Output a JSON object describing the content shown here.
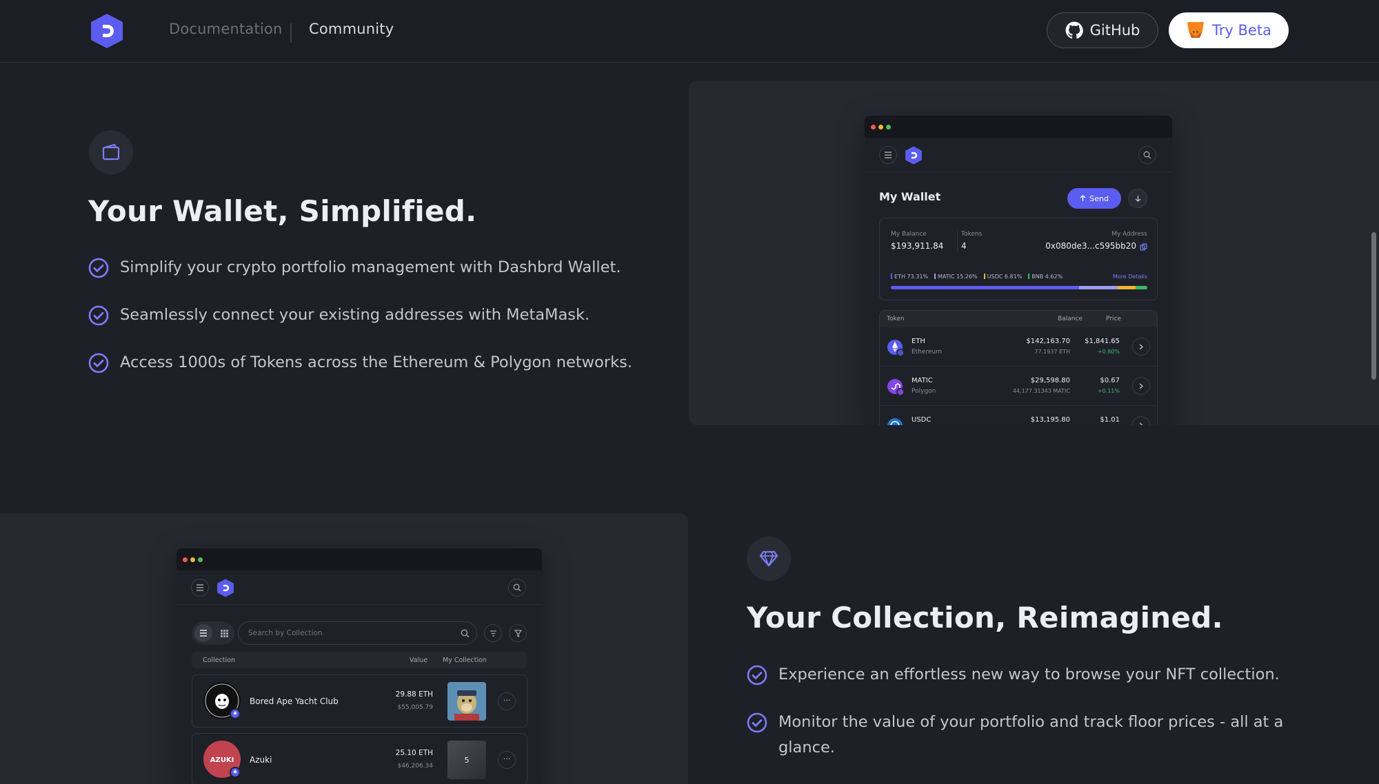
{
  "nav": {
    "links": [
      "Documentation",
      "Community"
    ],
    "github_label": "GitHub",
    "beta_label": "Try Beta"
  },
  "wallet_section": {
    "heading": "Your Wallet, Simplified.",
    "bullets": [
      "Simplify your crypto portfolio management with Dashbrd Wallet.",
      "Seamlessly connect your existing addresses with MetaMask.",
      "Access 1000s of Tokens across the Ethereum & Polygon networks."
    ]
  },
  "wallet_mock": {
    "title": "My Wallet",
    "send_label": "Send",
    "balance_label": "My Balance",
    "balance_value": "$193,911.84",
    "tokens_label": "Tokens",
    "tokens_value": "4",
    "address_label": "My Address",
    "address_value": "0x080de3...c595bb20",
    "allocation": [
      {
        "label": "ETH 73.31%",
        "share": 73.31,
        "color": "#5b5df0"
      },
      {
        "label": "MATIC 15.26%",
        "share": 15.26,
        "color": "#9b9bf5"
      },
      {
        "label": "USDC 6.81%",
        "share": 6.81,
        "color": "#f1b330"
      },
      {
        "label": "BNB 4.62%",
        "share": 4.62,
        "color": "#3fb86a"
      }
    ],
    "more_details": "More Details",
    "table_headers": [
      "Token",
      "Balance",
      "Price"
    ],
    "rows": [
      {
        "symbol": "ETH",
        "network": "Ethereum",
        "balance": "$142,163.70",
        "amount": "77.1937 ETH",
        "price": "$1,841.65",
        "change": "+0.80%"
      },
      {
        "symbol": "MATIC",
        "network": "Polygon",
        "balance": "$29,598.80",
        "amount": "44,177.31343 MATIC",
        "price": "$0.67",
        "change": "+0.11%"
      },
      {
        "symbol": "USDC",
        "network": "",
        "balance": "$13,195.80",
        "amount": "",
        "price": "$1.01",
        "change": ""
      }
    ]
  },
  "collection_section": {
    "heading": "Your Collection, Reimagined.",
    "bullets": [
      "Experience an effortless new way to browse your NFT collection.",
      "Monitor the value of your portfolio and track floor prices - all at a glance."
    ]
  },
  "collection_mock": {
    "search_placeholder": "Search by Collection",
    "table_headers": [
      "Collection",
      "Value",
      "My Collection"
    ],
    "rows": [
      {
        "name": "Bored Ape Yacht Club",
        "value": "29.88 ETH",
        "fiat": "$55,005.79",
        "count": ""
      },
      {
        "name": "Azuki",
        "value": "25.10 ETH",
        "fiat": "$46,206.34",
        "count": "5"
      }
    ],
    "azuki_logo_text": "AZUKI"
  }
}
